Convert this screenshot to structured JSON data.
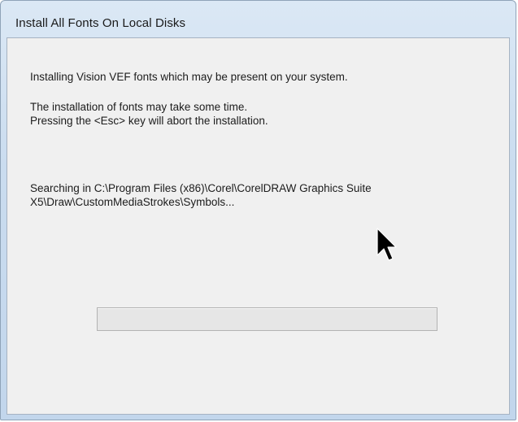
{
  "window": {
    "title": "Install All Fonts On Local Disks"
  },
  "content": {
    "intro": "Installing Vision VEF fonts which may be present on your system.",
    "time_note": "The installation of fonts may take some time.",
    "abort_note": "Pressing the <Esc> key will abort the installation.",
    "search_status": "Searching in C:\\Program Files (x86)\\Corel\\CorelDRAW Graphics Suite X5\\Draw\\CustomMediaStrokes\\Symbols..."
  },
  "progress": {
    "value_percent": 0
  },
  "icons": {
    "cursor": "mouse-pointer-icon"
  }
}
